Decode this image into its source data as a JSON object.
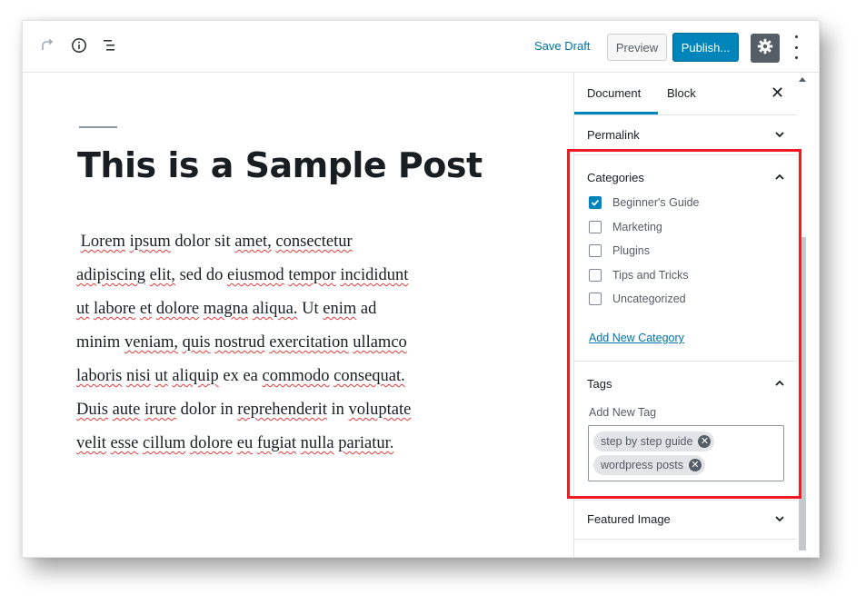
{
  "toolbar": {
    "redo_icon": "redo-icon",
    "info_icon": "info-icon",
    "outline_icon": "block-navigation-icon",
    "save_draft": "Save Draft",
    "preview": "Preview",
    "publish": "Publish...",
    "settings_icon": "gear-icon",
    "more_icon": "vertical-ellipsis-icon"
  },
  "editor": {
    "title": "This is a Sample Post",
    "body_words": [
      [
        "Lorem",
        true
      ],
      [
        "ipsum",
        true
      ],
      [
        "dolor",
        false
      ],
      [
        "sit",
        false
      ],
      [
        "amet,",
        true
      ],
      [
        "consectetur",
        true
      ],
      [
        "adipiscing",
        true
      ],
      [
        "elit,",
        true
      ],
      [
        "sed",
        false
      ],
      [
        "do",
        false
      ],
      [
        "eiusmod",
        true
      ],
      [
        "tempor",
        true
      ],
      [
        "incididunt",
        true
      ],
      [
        "ut",
        true
      ],
      [
        "labore",
        true
      ],
      [
        "et",
        true
      ],
      [
        "dolore",
        true
      ],
      [
        "magna",
        true
      ],
      [
        "aliqua.",
        true
      ],
      [
        "Ut",
        false
      ],
      [
        "enim",
        true
      ],
      [
        "ad",
        false
      ],
      [
        "minim",
        false
      ],
      [
        "veniam,",
        true
      ],
      [
        "quis",
        true
      ],
      [
        "nostrud",
        true
      ],
      [
        "exercitation",
        true
      ],
      [
        "ullamco",
        true
      ],
      [
        "laboris",
        true
      ],
      [
        "nisi",
        true
      ],
      [
        "ut",
        true
      ],
      [
        "aliquip",
        true
      ],
      [
        "ex",
        false
      ],
      [
        "ea",
        false
      ],
      [
        "commodo",
        true
      ],
      [
        "consequat.",
        true
      ],
      [
        "Duis",
        true
      ],
      [
        "aute",
        true
      ],
      [
        "irure",
        true
      ],
      [
        "dolor",
        false
      ],
      [
        "in",
        false
      ],
      [
        "reprehenderit",
        true
      ],
      [
        "in",
        false
      ],
      [
        "voluptate",
        true
      ],
      [
        "velit",
        true
      ],
      [
        "esse",
        true
      ],
      [
        "cillum",
        true
      ],
      [
        "dolore",
        true
      ],
      [
        "eu",
        true
      ],
      [
        "fugiat",
        true
      ],
      [
        "nulla",
        true
      ],
      [
        "pariatur.",
        true
      ]
    ]
  },
  "sidebar": {
    "tab_document": "Document",
    "tab_block": "Block",
    "close": "✕",
    "permalink": "Permalink",
    "categories": {
      "title": "Categories",
      "items": [
        {
          "label": "Beginner's Guide",
          "checked": true
        },
        {
          "label": "Marketing",
          "checked": false
        },
        {
          "label": "Plugins",
          "checked": false
        },
        {
          "label": "Tips and Tricks",
          "checked": false
        },
        {
          "label": "Uncategorized",
          "checked": false
        }
      ],
      "add_new": "Add New Category"
    },
    "tags": {
      "title": "Tags",
      "add_label": "Add New Tag",
      "items": [
        "step by step guide",
        "wordpress posts"
      ]
    },
    "featured_image": "Featured Image"
  },
  "colors": {
    "accent": "#0085ba",
    "highlight_box": "#ee1b24",
    "title_text": "#191e23"
  }
}
